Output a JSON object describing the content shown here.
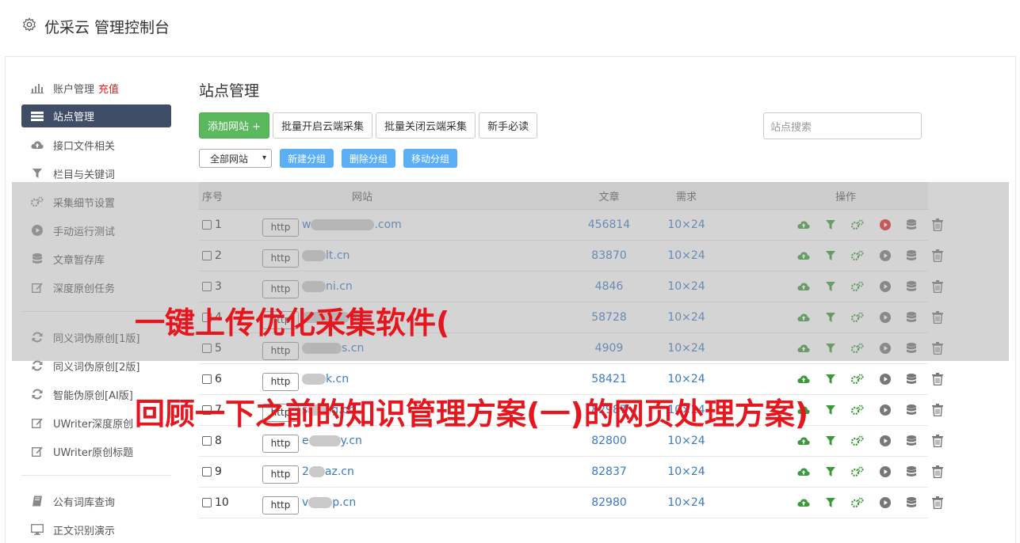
{
  "header": {
    "title": "优采云 管理控制台"
  },
  "sidebar": {
    "items": [
      {
        "label": "账户管理",
        "extra": "充值",
        "icon": "bar-chart-icon"
      },
      {
        "label": "站点管理",
        "icon": "server-icon",
        "active": true
      },
      {
        "label": "接口文件相关",
        "icon": "cloud-upload-icon"
      },
      {
        "label": "栏目与关键词",
        "icon": "filter-icon"
      },
      {
        "label": "采集细节设置",
        "icon": "cogs-icon"
      },
      {
        "label": "手动运行测试",
        "icon": "play-icon"
      },
      {
        "label": "文章暂存库",
        "icon": "database-icon"
      },
      {
        "label": "深度原创任务",
        "icon": "edit-icon"
      }
    ],
    "items2": [
      {
        "label": "同义词伪原创[1版]",
        "icon": "refresh-icon"
      },
      {
        "label": "同义词伪原创[2版]",
        "icon": "refresh-icon"
      },
      {
        "label": "智能伪原创[AI版]",
        "icon": "refresh-icon"
      },
      {
        "label": "UWriter深度原创",
        "icon": "edit-icon"
      },
      {
        "label": "UWriter原创标题",
        "icon": "edit-icon"
      }
    ],
    "items3": [
      {
        "label": "公有词库查询",
        "icon": "book-icon"
      },
      {
        "label": "正文识别演示",
        "icon": "monitor-icon"
      }
    ]
  },
  "main": {
    "title": "站点管理",
    "buttons": {
      "add": "添加网站 +",
      "batch_open": "批量开启云端采集",
      "batch_close": "批量关闭云端采集",
      "guide": "新手必读"
    },
    "search_placeholder": "站点搜索",
    "group_select": "全部网站",
    "group_buttons": {
      "new": "新建分组",
      "delete": "删除分组",
      "move": "移动分组"
    },
    "table": {
      "headers": {
        "no": "序号",
        "site": "网站",
        "articles": "文章",
        "need": "需求",
        "ops": "操作"
      },
      "rows": [
        {
          "no": "1",
          "prefix": "w",
          "suffix": ".com",
          "articles": "456814",
          "need": "10×24",
          "running": true
        },
        {
          "no": "2",
          "prefix": "",
          "suffix": "lt.cn",
          "articles": "83870",
          "need": "10×24",
          "running": false
        },
        {
          "no": "3",
          "prefix": "",
          "suffix": "ni.cn",
          "articles": "4846",
          "need": "10×24",
          "running": false
        },
        {
          "no": "4",
          "prefix": "",
          "suffix": "n",
          "articles": "58728",
          "need": "10×24",
          "running": false
        },
        {
          "no": "5",
          "prefix": "",
          "suffix": "s.cn",
          "articles": "4909",
          "need": "10×24",
          "running": false
        },
        {
          "no": "6",
          "prefix": "",
          "suffix": "k.cn",
          "articles": "58421",
          "need": "10×24",
          "running": false
        },
        {
          "no": "7",
          "prefix": "s",
          "suffix": "g.cn",
          "articles": "82987",
          "need": "10×24",
          "running": false
        },
        {
          "no": "8",
          "prefix": "e",
          "suffix": "y.cn",
          "articles": "82800",
          "need": "10×24",
          "running": false
        },
        {
          "no": "9",
          "prefix": "2",
          "suffix": "az.cn",
          "articles": "82837",
          "need": "10×24",
          "running": false
        },
        {
          "no": "10",
          "prefix": "v",
          "suffix": "p.cn",
          "articles": "82980",
          "need": "10×24",
          "running": false
        }
      ],
      "http_label": "http"
    }
  },
  "overlay": {
    "caption1": "一键上传优化采集软件(",
    "caption2": "回顾一下之前的知识管理方案(一)的网页处理方案)"
  },
  "colors": {
    "accent_green": "#5cb85c",
    "accent_blue": "#5bb0f5",
    "active_nav": "#3f4d67",
    "caption_red": "#e6161f"
  }
}
